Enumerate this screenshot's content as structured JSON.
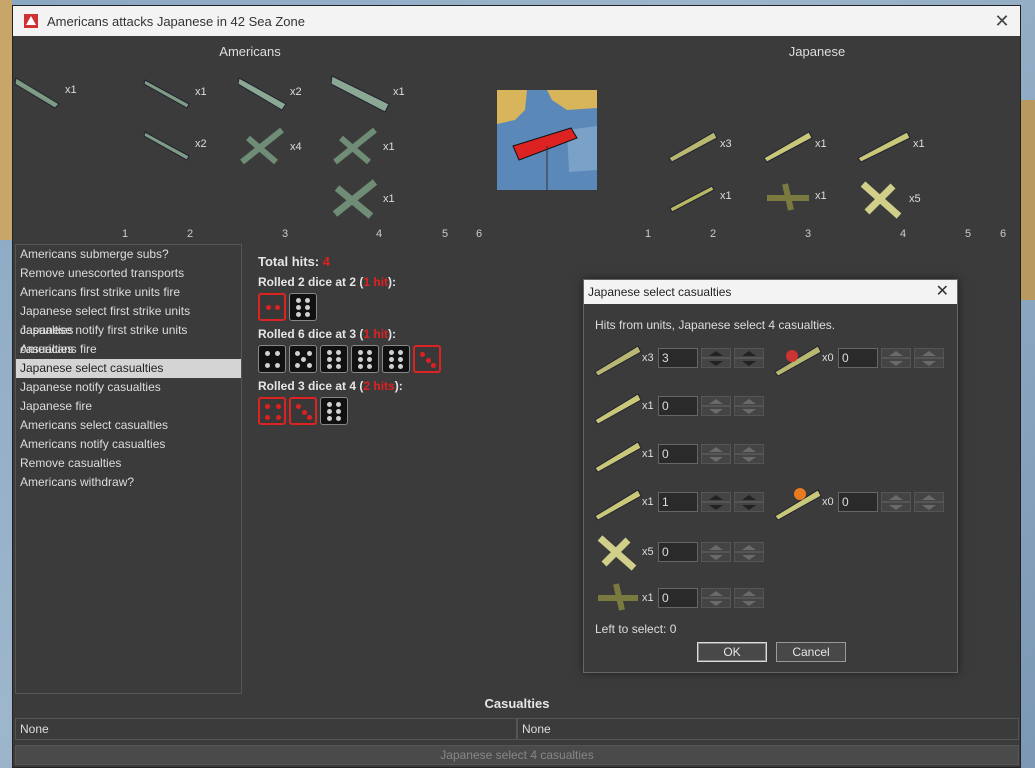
{
  "window": {
    "title": "Americans attacks Japanese in 42 Sea Zone"
  },
  "americans": {
    "header": "Americans",
    "units": [
      {
        "name": "submarine",
        "count": "x1"
      },
      {
        "name": "transport",
        "count": "x1"
      },
      {
        "name": "destroyer",
        "count": "x2"
      },
      {
        "name": "cruiser",
        "count": "x1"
      },
      {
        "name": "battleship-ship",
        "count": "x2"
      },
      {
        "name": "fighter",
        "count": "x4"
      },
      {
        "name": "fighter2",
        "count": "x1"
      },
      {
        "name": "bomber",
        "count": "x1"
      }
    ],
    "axis": [
      "1",
      "2",
      "3",
      "4",
      "5",
      "6"
    ]
  },
  "japanese": {
    "header": "Japanese",
    "units": [
      {
        "name": "carrier",
        "count": "x3"
      },
      {
        "name": "cruiser",
        "count": "x1"
      },
      {
        "name": "battleship",
        "count": "x1"
      },
      {
        "name": "submarine",
        "count": "x1"
      },
      {
        "name": "fighter",
        "count": "x1"
      },
      {
        "name": "fighter2",
        "count": "x5"
      }
    ],
    "axis": [
      "1",
      "2",
      "3",
      "4",
      "5",
      "6"
    ]
  },
  "steps": [
    "Americans submerge subs?",
    "Remove unescorted transports",
    "Americans first strike units fire",
    "Japanese select first strike units casualties",
    "Japanese notify first strike units casualties",
    "Americans fire",
    "Japanese select casualties",
    "Japanese notify casualties",
    "Japanese fire",
    "Americans select casualties",
    "Americans notify casualties",
    "Remove casualties",
    "Americans withdraw?"
  ],
  "selected_step": "Japanese select casualties",
  "dice_panel": {
    "total_label": "Total hits:",
    "total_value": "4",
    "rolls": [
      {
        "prefix": "Rolled 2 dice at 2 (",
        "hits": "1 hit",
        "suffix": "):"
      },
      {
        "prefix": "Rolled 6 dice at 3 (",
        "hits": "1 hit",
        "suffix": "):"
      },
      {
        "prefix": "Rolled 3 dice at 4 (",
        "hits": "2 hits",
        "suffix": "):"
      }
    ]
  },
  "dialog": {
    "title": "Japanese select casualties",
    "instruction": "Hits from units,  Japanese select 4 casualties.",
    "rows": [
      {
        "count": "x3",
        "value": "3",
        "damaged_count": "x0",
        "damaged_value": "0"
      },
      {
        "count": "x1",
        "value": "0"
      },
      {
        "count": "x1",
        "value": "0"
      },
      {
        "count": "x1",
        "value": "1",
        "damaged_count": "x0",
        "damaged_value": "0"
      },
      {
        "count": "x5",
        "value": "0"
      },
      {
        "count": "x1",
        "value": "0"
      }
    ],
    "left_to_select": "Left to select: 0",
    "ok": "OK",
    "cancel": "Cancel"
  },
  "casualties": {
    "header": "Casualties",
    "left": "None",
    "right": "None"
  },
  "status": "Japanese select 4 casualties",
  "colors": {
    "hit": "#e02020",
    "panel": "#3b3b3b"
  }
}
